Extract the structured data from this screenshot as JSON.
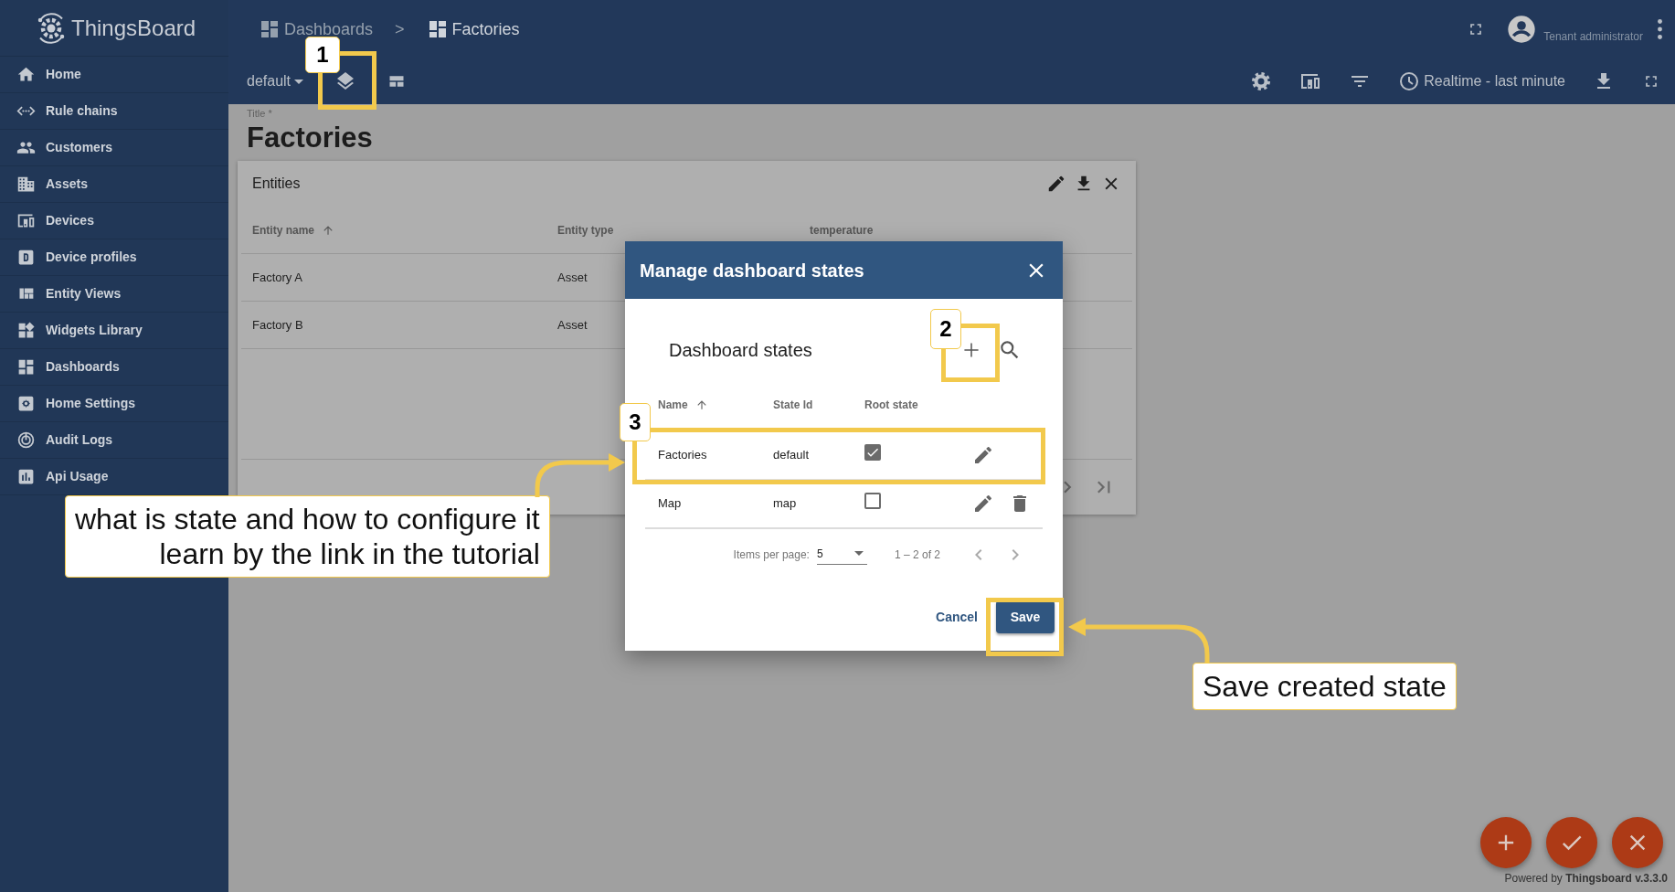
{
  "sidebar": {
    "logo_text": "ThingsBoard",
    "items": [
      {
        "label": "Home"
      },
      {
        "label": "Rule chains"
      },
      {
        "label": "Customers"
      },
      {
        "label": "Assets"
      },
      {
        "label": "Devices"
      },
      {
        "label": "Device profiles"
      },
      {
        "label": "Entity Views"
      },
      {
        "label": "Widgets Library"
      },
      {
        "label": "Dashboards"
      },
      {
        "label": "Home Settings"
      },
      {
        "label": "Audit Logs"
      },
      {
        "label": "Api Usage"
      }
    ]
  },
  "header": {
    "breadcrumbs": [
      {
        "label": "Dashboards"
      },
      {
        "label": "Factories"
      }
    ],
    "separator": ">",
    "user_role": "Tenant administrator",
    "state_select": "default",
    "timewindow": "Realtime - last minute"
  },
  "dashboard": {
    "title_label": "Title *",
    "title": "Factories"
  },
  "widget": {
    "title": "Entities",
    "columns": [
      {
        "label": "Entity name",
        "sorted": true
      },
      {
        "label": "Entity type",
        "sorted": false
      },
      {
        "label": "temperature",
        "sorted": false
      }
    ],
    "rows": [
      [
        "Factory A",
        "Asset"
      ],
      [
        "Factory B",
        "Asset"
      ]
    ]
  },
  "dialog": {
    "title": "Manage dashboard states",
    "section_title": "Dashboard states",
    "columns": [
      {
        "label": "Name",
        "sorted": true
      },
      {
        "label": "State Id",
        "sorted": false
      },
      {
        "label": "Root state",
        "sorted": false
      }
    ],
    "rows": [
      {
        "name": "Factories",
        "state_id": "default",
        "root_state": true,
        "actions": [
          {
            "kind": "edit"
          }
        ]
      },
      {
        "name": "Map",
        "state_id": "map",
        "root_state": false,
        "actions": [
          {
            "kind": "edit"
          },
          {
            "kind": "delete"
          }
        ]
      }
    ],
    "pagination": {
      "label": "Items per page:",
      "page_size": "5",
      "range": "1 – 2 of 2"
    },
    "buttons": {
      "cancel": "Cancel",
      "save": "Save"
    }
  },
  "annotations": {
    "steps": [
      {
        "number": "1"
      },
      {
        "number": "2"
      },
      {
        "number": "3"
      }
    ],
    "callouts": [
      {
        "lines": [
          "what is state and how to configure it",
          "learn by the link in the tutorial"
        ]
      },
      {
        "lines": [
          "Save created state"
        ]
      }
    ]
  },
  "footer": {
    "powered_by": "Powered by",
    "link": "Thingsboard v.3.3.0"
  }
}
